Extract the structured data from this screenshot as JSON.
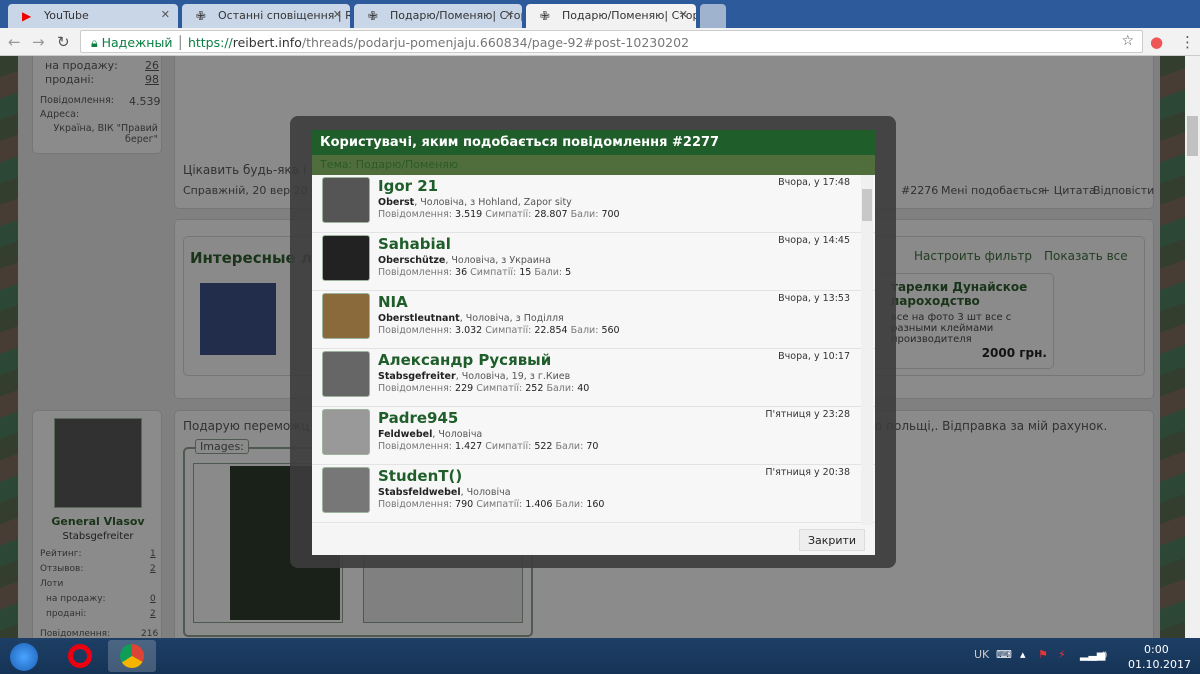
{
  "browser": {
    "tabs": [
      {
        "title": "YouTube",
        "icon": "youtube-icon"
      },
      {
        "title": "Останні сповіщення | RE",
        "icon": "cross-icon"
      },
      {
        "title": "Подарю/Поменяю| Стор",
        "icon": "cross-icon"
      },
      {
        "title": "Подарю/Поменяю| Стор",
        "icon": "cross-icon"
      }
    ],
    "secure_label": "Надежный",
    "url_scheme": "https://",
    "url_host": "reibert.info",
    "url_path": "/threads/podarju-pomenjaju.660834/page-92#post-10230202"
  },
  "background": {
    "user1": {
      "for_sale_label": "на продажу:",
      "for_sale": "26",
      "sold_label": "продані:",
      "sold": "98",
      "messages_label": "Повідомлення:",
      "messages": "4.539",
      "address_label": "Адреса:",
      "address": "Україна, ВІК \"Правий берег\""
    },
    "post1_text": "Цікавить будь-яка і",
    "post1_meta": "Справжній, 20 вер 20",
    "post1_actions": {
      "num": "#2276",
      "like": "Мені подобається",
      "quote": "+ Цитата",
      "reply": "Відповісти"
    },
    "lots": {
      "title": "Интересные л",
      "filter": "Настроить фильтр",
      "show_all": "Показать все",
      "item_title": "тарелки Дунайское пароходство",
      "item_desc": "все на фото 3 шт все с разными клеймами производителя",
      "price": "2000 грн."
    },
    "user2": {
      "name": "General Vlasov",
      "rank": "Stabsgefreiter",
      "rating_label": "Рейтинг:",
      "rating": "1",
      "reviews_label": "Отзывов:",
      "reviews": "2",
      "lots_label": "Лоти",
      "for_sale_label": "на продажу:",
      "for_sale": "0",
      "sold_label": "продані:",
      "sold": "2",
      "messages_label": "Повідомлення:",
      "messages": "216"
    },
    "post2_text": "Подарую переможц",
    "post2_text_end": "о польщі,. Відправка за мій рахунок.",
    "images_label": "Images:"
  },
  "modal": {
    "title": "Користувачі, яким подобається повідомлення #2277",
    "topic_label": "Тема:",
    "topic": "Подарю/Поменяю",
    "close_label": "Закрити",
    "labels": {
      "messages": "Повідомлення:",
      "likes": "Симпатії:",
      "points": "Бали:"
    },
    "users": [
      {
        "name": "Igor 21",
        "rank": "Oberst",
        "info": ", Чоловіча, з Hohland, Zapor sity",
        "messages": "3.519",
        "likes": "28.807",
        "points": "700",
        "time": "Вчора, у 17:48"
      },
      {
        "name": "Sahabial",
        "rank": "Oberschütze",
        "info": ", Чоловіча, з Украина",
        "messages": "36",
        "likes": "15",
        "points": "5",
        "time": "Вчора, у 14:45"
      },
      {
        "name": "NIA",
        "rank": "Oberstleutnant",
        "info": ", Чоловіча, з Поділля",
        "messages": "3.032",
        "likes": "22.854",
        "points": "560",
        "time": "Вчора, у 13:53"
      },
      {
        "name": "Александр Русявый",
        "rank": "Stabsgefreiter",
        "info": ", Чоловіча, 19, з г.Киев",
        "messages": "229",
        "likes": "252",
        "points": "40",
        "time": "Вчора, у 10:17"
      },
      {
        "name": "Padre945",
        "rank": "Feldwebel",
        "info": ", Чоловіча",
        "messages": "1.427",
        "likes": "522",
        "points": "70",
        "time": "П'ятниця у 23:28"
      },
      {
        "name": "StudenT()",
        "rank": "Stabsfeldwebel",
        "info": ", Чоловіча",
        "messages": "790",
        "likes": "1.406",
        "points": "160",
        "time": "П'ятниця у 20:38"
      }
    ]
  },
  "taskbar": {
    "lang": "UK",
    "time": "0:00",
    "date": "01.10.2017"
  }
}
